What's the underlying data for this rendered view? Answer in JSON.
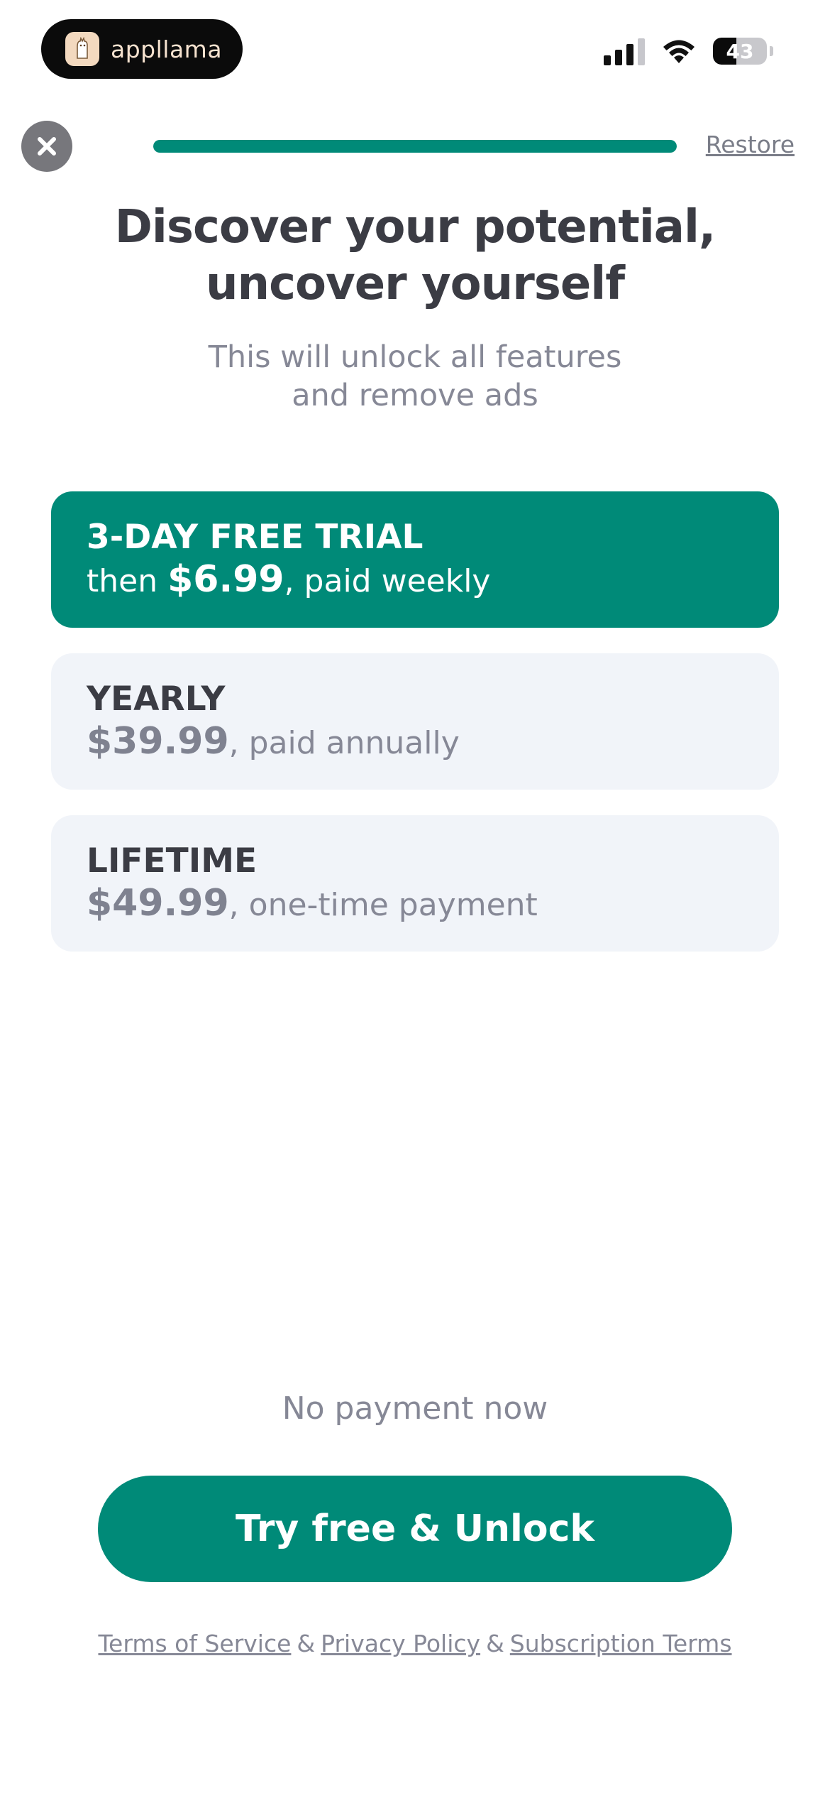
{
  "status_bar": {
    "app_name": "appllama",
    "battery_level": "43",
    "battery_fraction": 0.43,
    "icons": [
      "app-logo-icon",
      "signal-icon",
      "wifi-icon",
      "battery-icon"
    ]
  },
  "header": {
    "close_icon": "close-icon",
    "progress_fraction": 1.0,
    "restore_label": "Restore"
  },
  "headline": {
    "line1": "Discover your potential,",
    "line2": "uncover yourself"
  },
  "subtitle": {
    "line1": "This will unlock all features",
    "line2": "and remove ads"
  },
  "plans": [
    {
      "title": "3-DAY FREE TRIAL",
      "prefix": "then ",
      "price": "$6.99",
      "suffix": ", paid weekly",
      "selected": true
    },
    {
      "title": "YEARLY",
      "prefix": "",
      "price": "$39.99",
      "suffix": ", paid annually",
      "selected": false
    },
    {
      "title": "LIFETIME",
      "prefix": "",
      "price": "$49.99",
      "suffix": ", one-time payment",
      "selected": false
    }
  ],
  "footer": {
    "no_payment": "No payment now",
    "cta_label": "Try free & Unlock",
    "terms_label": "Terms of Service",
    "privacy_label": "Privacy Policy",
    "subscription_label": "Subscription Terms",
    "separator": "&"
  },
  "colors": {
    "accent": "#008a78",
    "card_bg": "#f1f4f9",
    "heading": "#3b3c44",
    "muted": "#868896"
  }
}
